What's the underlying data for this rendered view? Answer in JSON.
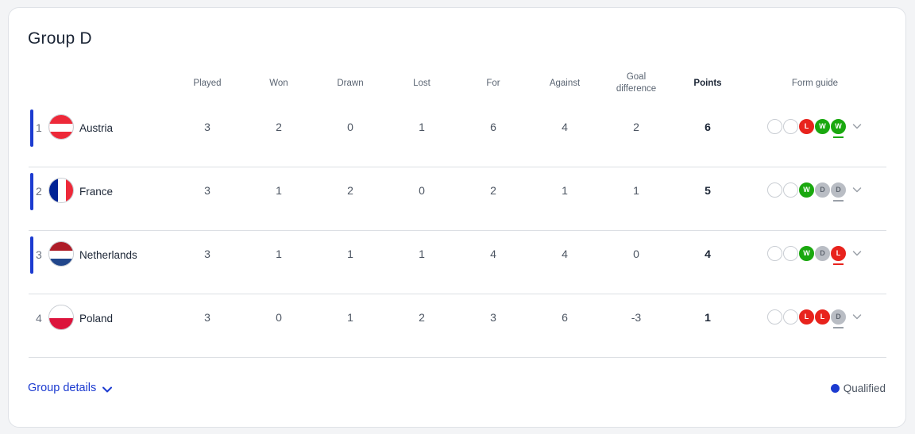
{
  "group": {
    "title": "Group D"
  },
  "columns": {
    "played": "Played",
    "won": "Won",
    "drawn": "Drawn",
    "lost": "Lost",
    "for": "For",
    "against": "Against",
    "goal_difference_1": "Goal",
    "goal_difference_2": "difference",
    "points": "Points",
    "form_guide": "Form guide"
  },
  "rows": [
    {
      "position": "1",
      "team": "Austria",
      "flag": "austria-flag",
      "qualified": true,
      "played": "3",
      "won": "2",
      "drawn": "0",
      "lost": "1",
      "for": "6",
      "against": "4",
      "gd": "2",
      "points": "6",
      "form": [
        "",
        "",
        "L",
        "W",
        "W"
      ]
    },
    {
      "position": "2",
      "team": "France",
      "flag": "france-flag",
      "qualified": true,
      "played": "3",
      "won": "1",
      "drawn": "2",
      "lost": "0",
      "for": "2",
      "against": "1",
      "gd": "1",
      "points": "5",
      "form": [
        "",
        "",
        "W",
        "D",
        "D"
      ]
    },
    {
      "position": "3",
      "team": "Netherlands",
      "flag": "netherlands-flag",
      "qualified": true,
      "played": "3",
      "won": "1",
      "drawn": "1",
      "lost": "1",
      "for": "4",
      "against": "4",
      "gd": "0",
      "points": "4",
      "form": [
        "",
        "",
        "W",
        "D",
        "L"
      ]
    },
    {
      "position": "4",
      "team": "Poland",
      "flag": "poland-flag",
      "qualified": false,
      "played": "3",
      "won": "0",
      "drawn": "1",
      "lost": "2",
      "for": "3",
      "against": "6",
      "gd": "-3",
      "points": "1",
      "form": [
        "",
        "",
        "L",
        "L",
        "D"
      ]
    }
  ],
  "footer": {
    "group_details": "Group details",
    "legend_label": "Qualified"
  },
  "colors": {
    "qualified": "#1c3bd0",
    "win": "#1aa80f",
    "loss": "#e8231d",
    "draw": "#b9bdc4"
  }
}
